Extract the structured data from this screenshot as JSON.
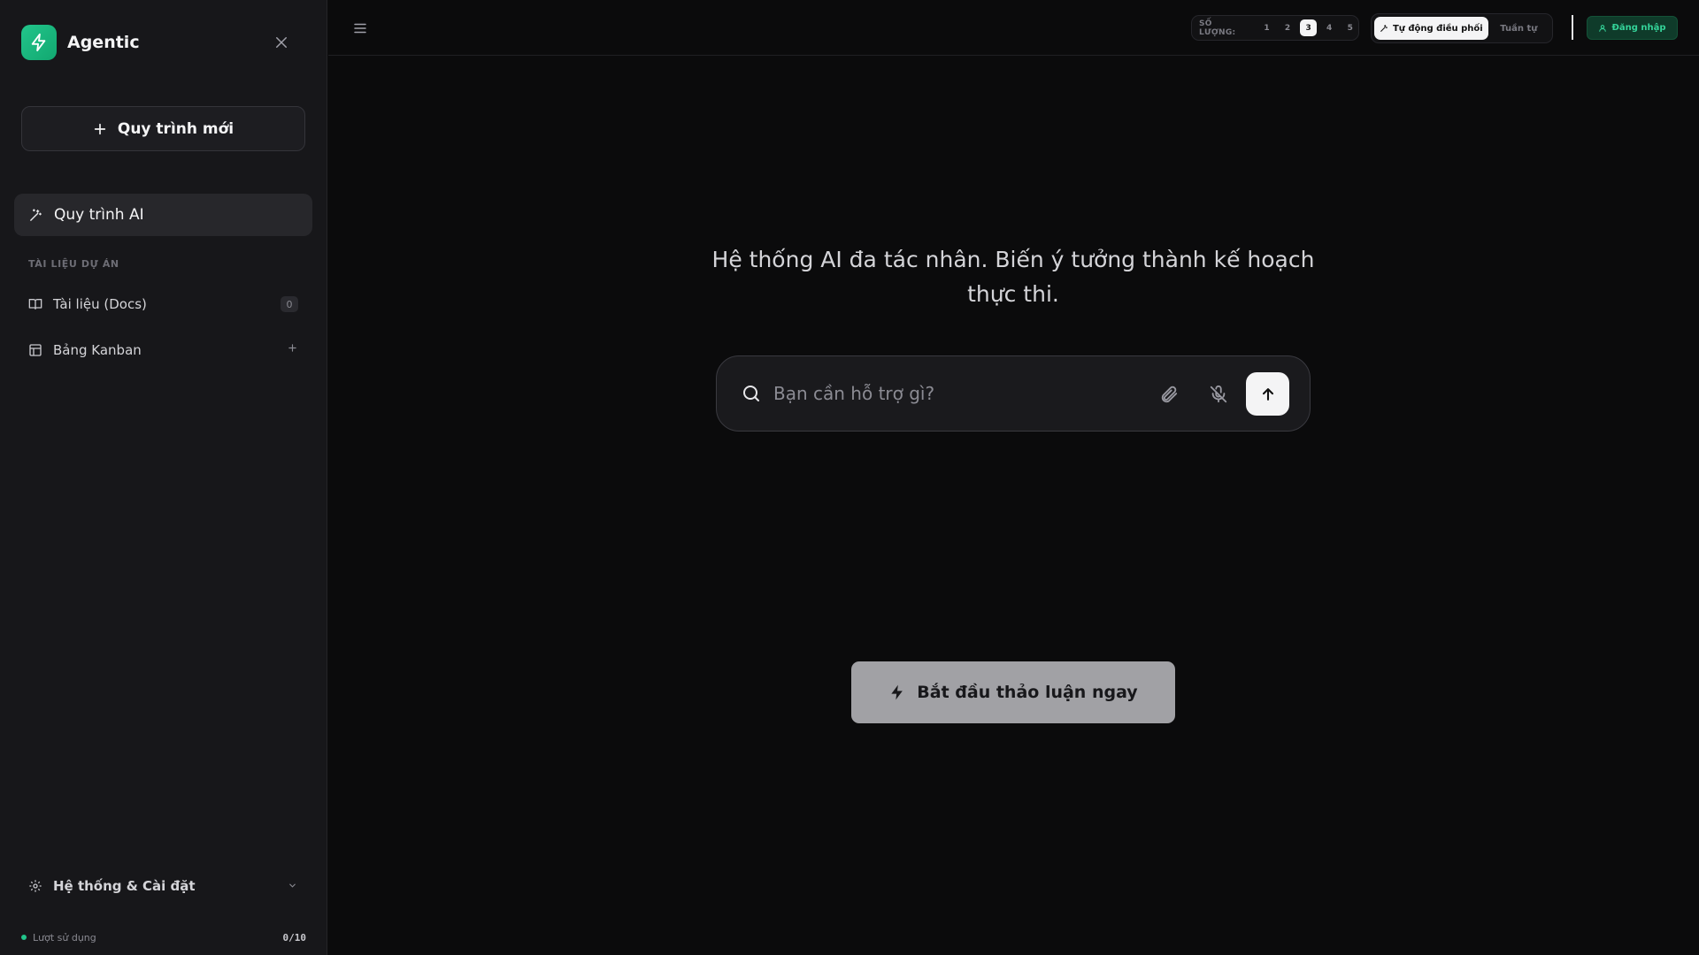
{
  "sidebar": {
    "brand_name": "Agentic",
    "new_workflow_label": "Quy trình mới",
    "active_item_label": "Quy trình AI",
    "section_label": "TÀI LIỆU DỰ ÁN",
    "items": [
      {
        "label": "Tài liệu (Docs)",
        "badge": "0",
        "icon": "book-open-icon"
      },
      {
        "label": "Bảng Kanban",
        "icon": "kanban-board-icon"
      }
    ],
    "settings_label": "Hệ thống & Cài đặt",
    "usage_label": "Lượt sử dụng",
    "usage_count": "0/10"
  },
  "topbar": {
    "quantity_label": "SỐ LƯỢNG:",
    "quantity_options": [
      "1",
      "2",
      "3",
      "4",
      "5"
    ],
    "quantity_selected": "3",
    "mode_auto": "Tự động điều phối",
    "mode_sequential": "Tuần tự",
    "login_label": "Đăng nhập"
  },
  "main": {
    "headline": "Hệ thống AI đa tác nhân. Biến ý tưởng thành kế hoạch thực thi.",
    "search_placeholder": "Bạn cần hỗ trợ gì?",
    "start_button": "Bắt đầu thảo luận ngay"
  },
  "colors": {
    "accent": "#22c58b",
    "background": "#0b0b0c",
    "sidebar": "#17171a"
  }
}
